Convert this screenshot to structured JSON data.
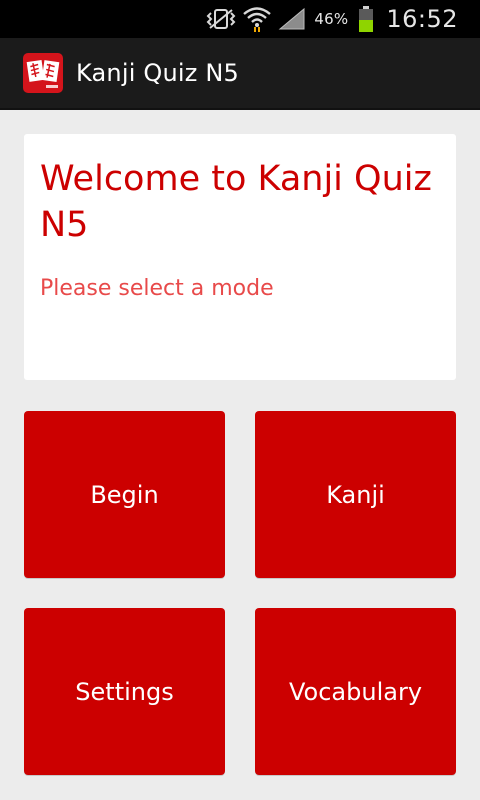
{
  "status_bar": {
    "battery_percent": "46%",
    "time": "16:52",
    "icons": [
      "vibrate-icon",
      "wifi-icon",
      "signal-icon",
      "battery-icon"
    ]
  },
  "action_bar": {
    "title": "Kanji Quiz N5",
    "app_icon": "kanji-app-icon"
  },
  "welcome": {
    "title": "Welcome to Kanji Quiz N5",
    "subtitle": "Please select a mode"
  },
  "modes": {
    "begin": "Begin",
    "kanji": "Kanji",
    "settings": "Settings",
    "vocabulary": "Vocabulary"
  },
  "colors": {
    "accent": "#cc0000",
    "subtitle": "#e84a4a",
    "background": "#ececec",
    "action_bar": "#1b1b1b",
    "battery": "#8fd400"
  }
}
